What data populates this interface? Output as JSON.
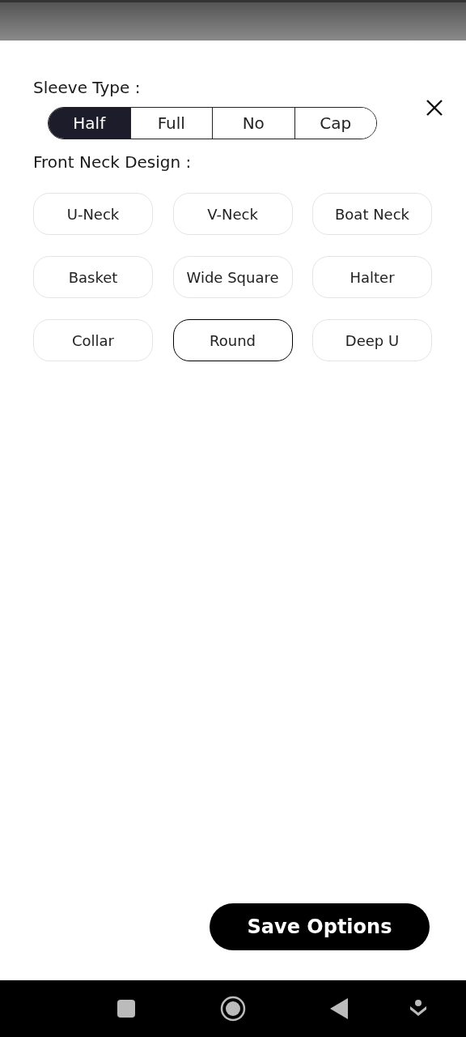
{
  "sleeve_type": {
    "label": "Sleeve Type :",
    "options": [
      {
        "label": "Half",
        "selected": true
      },
      {
        "label": "Full",
        "selected": false
      },
      {
        "label": "No",
        "selected": false
      },
      {
        "label": "Cap",
        "selected": false
      }
    ]
  },
  "front_neck_design": {
    "label": "Front Neck Design :",
    "options": [
      {
        "label": "U-Neck",
        "selected": false
      },
      {
        "label": "V-Neck",
        "selected": false
      },
      {
        "label": "Boat Neck",
        "selected": false
      },
      {
        "label": "Basket",
        "selected": false
      },
      {
        "label": "Wide Square",
        "selected": false
      },
      {
        "label": "Halter",
        "selected": false
      },
      {
        "label": "Collar",
        "selected": false
      },
      {
        "label": "Round",
        "selected": true
      },
      {
        "label": "Deep U",
        "selected": false
      }
    ]
  },
  "save_button": "Save Options"
}
